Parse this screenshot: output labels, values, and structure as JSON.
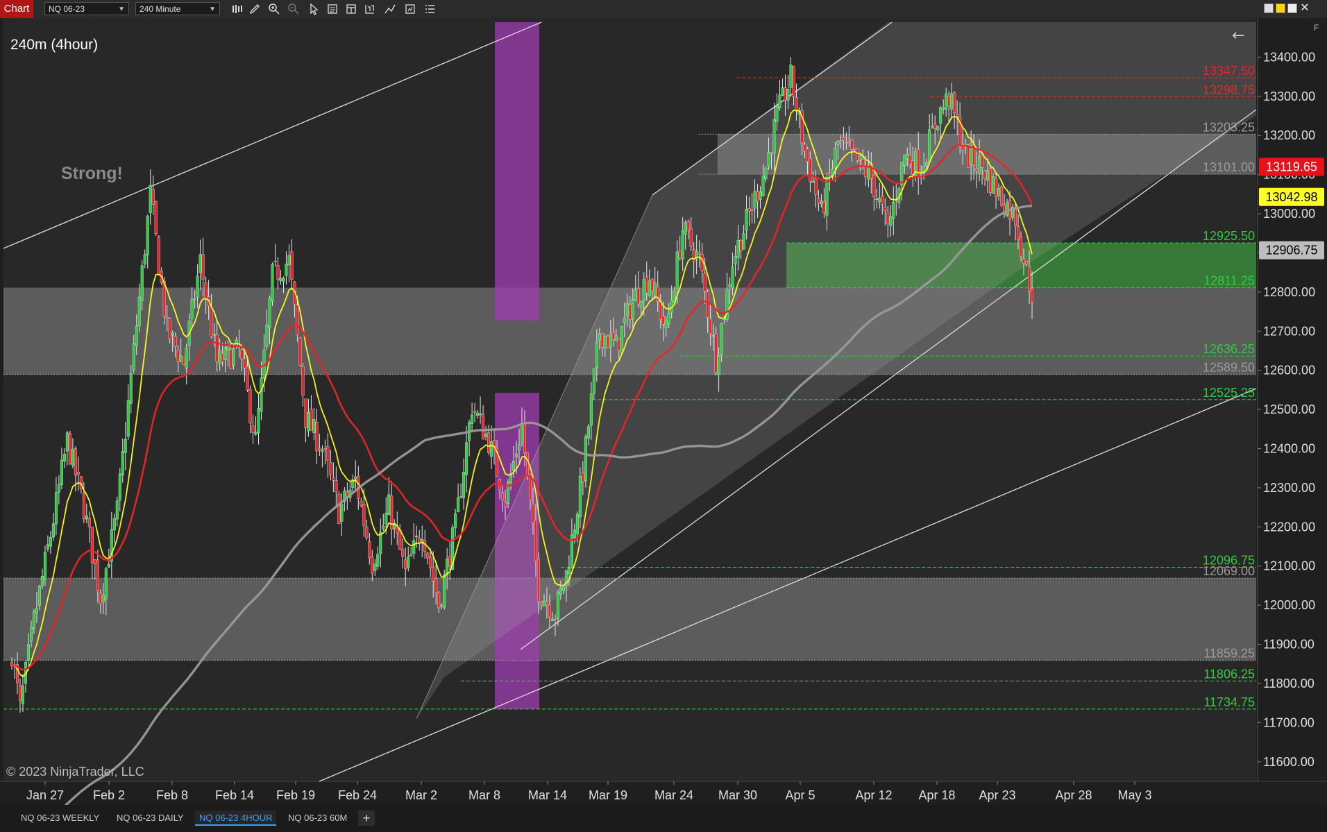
{
  "toolbar": {
    "chart_label": "Chart",
    "instrument": "NQ 06-23",
    "period": "240 Minute",
    "icons": [
      "bar-type-icon",
      "draw-pencil-icon",
      "zoom-in-icon",
      "zoom-out-icon",
      "pointer-icon",
      "data-box-icon",
      "properties-icon",
      "strategy-icon",
      "drawing-tools-icon",
      "templates-icon",
      "list-icon"
    ],
    "window_buttons": [
      "tile-icon",
      "restore-icon",
      "maximize-icon",
      "close-icon"
    ]
  },
  "chart": {
    "title": "240m (4hour)",
    "annotation": "Strong!",
    "copyright": "© 2023 NinjaTrader, LLC",
    "back_arrow": "←",
    "f_label": "F",
    "colors": {
      "background": "#282828",
      "ema_fast": "#ffff22",
      "ema_mid": "#e8262a",
      "sma_slow": "#9a9a9a",
      "up_candle": "#2ecc40",
      "down_candle": "#e8262a",
      "purple": "#a03cb0",
      "green_zone": "#3a8a3a"
    }
  },
  "chart_data": {
    "type": "candlestick",
    "instrument": "NQ 06-23",
    "interval": "240 Minute",
    "ylim": [
      11550,
      13500
    ],
    "y_ticks": [
      11600,
      11700,
      11800,
      11900,
      12000,
      12100,
      12200,
      12300,
      12400,
      12500,
      12600,
      12700,
      12800,
      12900,
      13000,
      13100,
      13200,
      13300,
      13400
    ],
    "y_tick_labels": [
      "11600.00",
      "11700.00",
      "11800.00",
      "11900.00",
      "12000.00",
      "12100.00",
      "12200.00",
      "12300.00",
      "12400.00",
      "12500.00",
      "12600.00",
      "12700.00",
      "12800.00",
      "12900.00",
      "13000.00",
      "13100.00",
      "13200.00",
      "13300.00",
      "13400.00"
    ],
    "x_labels": [
      "Jan 27",
      "Feb 2",
      "Feb 8",
      "Feb 14",
      "Feb 19",
      "Feb 24",
      "Mar 2",
      "Mar 8",
      "Mar 14",
      "Mar 19",
      "Mar 24",
      "Mar 30",
      "Apr 5",
      "Apr 12",
      "Apr 18",
      "Apr 23",
      "Apr 28",
      "May 3"
    ],
    "bars_total": 300,
    "bars_with_data": 289,
    "price_anchors": [
      [
        0,
        11880
      ],
      [
        3,
        11735
      ],
      [
        8,
        11960
      ],
      [
        14,
        12180
      ],
      [
        20,
        12420
      ],
      [
        26,
        12250
      ],
      [
        32,
        12020
      ],
      [
        38,
        12240
      ],
      [
        44,
        12650
      ],
      [
        50,
        13050
      ],
      [
        56,
        12700
      ],
      [
        62,
        12620
      ],
      [
        68,
        12880
      ],
      [
        74,
        12620
      ],
      [
        82,
        12650
      ],
      [
        88,
        12420
      ],
      [
        94,
        12840
      ],
      [
        100,
        12880
      ],
      [
        106,
        12480
      ],
      [
        112,
        12400
      ],
      [
        118,
        12240
      ],
      [
        124,
        12320
      ],
      [
        130,
        12110
      ],
      [
        136,
        12250
      ],
      [
        142,
        12080
      ],
      [
        148,
        12200
      ],
      [
        154,
        12000
      ],
      [
        160,
        12200
      ],
      [
        166,
        12510
      ],
      [
        172,
        12420
      ],
      [
        178,
        12270
      ],
      [
        184,
        12460
      ],
      [
        190,
        12040
      ],
      [
        196,
        11980
      ],
      [
        200,
        12080
      ],
      [
        206,
        12340
      ],
      [
        212,
        12700
      ],
      [
        218,
        12660
      ],
      [
        224,
        12780
      ],
      [
        230,
        12840
      ],
      [
        236,
        12700
      ],
      [
        242,
        12960
      ],
      [
        248,
        12880
      ],
      [
        254,
        12630
      ],
      [
        260,
        12880
      ],
      [
        266,
        13000
      ],
      [
        272,
        13120
      ],
      [
        276,
        13250
      ],
      [
        281,
        13347
      ],
      [
        286,
        13160
      ],
      [
        292,
        13000
      ],
      [
        298,
        13180
      ],
      [
        304,
        13140
      ],
      [
        310,
        13090
      ],
      [
        316,
        12960
      ],
      [
        322,
        13150
      ],
      [
        328,
        13120
      ],
      [
        334,
        13250
      ],
      [
        338,
        13298
      ],
      [
        344,
        13150
      ],
      [
        350,
        13120
      ],
      [
        356,
        13050
      ],
      [
        362,
        12990
      ],
      [
        366,
        12850
      ],
      [
        368,
        12800
      ]
    ],
    "levels": [
      {
        "price": 13347.5,
        "label": "13347.50",
        "color": "#e8262a",
        "style": "dashed",
        "x_start": 0.585
      },
      {
        "price": 13298.75,
        "label": "13298.75",
        "color": "#e8262a",
        "style": "dashed",
        "x_start": 0.74
      },
      {
        "price": 13203.25,
        "label": "13203.25",
        "color": "#9a9a9a",
        "style": "dotted",
        "x_start": 0.555
      },
      {
        "price": 13101.0,
        "label": "13101.00",
        "color": "#9a9a9a",
        "style": "dotted",
        "x_start": 0.555
      },
      {
        "price": 12925.5,
        "label": "12925.50",
        "color": "#2ecc40",
        "style": "dashed",
        "x_start": 0.625
      },
      {
        "price": 12811.25,
        "label": "12811.25",
        "color": "#2ecc40",
        "style": "dashed",
        "x_start": 0.625
      },
      {
        "price": 12636.25,
        "label": "12636.25",
        "color": "#2ecc40",
        "style": "dashed",
        "x_start": 0.54
      },
      {
        "price": 12589.5,
        "label": "12589.50",
        "color": "#9a9a9a",
        "style": "dotted",
        "x_start": 0
      },
      {
        "price": 12525.25,
        "label": "12525.25",
        "color": "#2ecc40",
        "style": "dashed",
        "x_start": 0.47
      },
      {
        "price": 12096.75,
        "label": "12096.75",
        "color": "#2ecc40",
        "style": "dashed",
        "x_start": 0.445
      },
      {
        "price": 12069.0,
        "label": "12069.00",
        "color": "#9a9a9a",
        "style": "dotted",
        "x_start": 0
      },
      {
        "price": 11859.25,
        "label": "11859.25",
        "color": "#9a9a9a",
        "style": "dotted",
        "x_start": 0
      },
      {
        "price": 11806.25,
        "label": "11806.25",
        "color": "#2ecc40",
        "style": "dashed",
        "x_start": 0.365
      },
      {
        "price": 11734.75,
        "label": "11734.75",
        "color": "#2ecc40",
        "style": "dashed",
        "x_start": 0
      }
    ],
    "price_tags": [
      {
        "price": 13119.65,
        "label": "13119.65",
        "bg": "#e8101a",
        "fg": "#ffffff"
      },
      {
        "price": 13042.98,
        "label": "13042.98",
        "bg": "#ffff22",
        "fg": "#000000"
      },
      {
        "price": 12906.75,
        "label": "12906.75",
        "bg": "#bdbdbd",
        "fg": "#000000"
      }
    ],
    "zones": [
      {
        "name": "upper-grey-zone",
        "from_price": 12589.5,
        "to_price": 12811.25,
        "x_start": 0,
        "x_end": 1,
        "color": "rgba(190,190,190,0.35)"
      },
      {
        "name": "lower-grey-zone",
        "from_price": 11859.25,
        "to_price": 12069.0,
        "x_start": 0,
        "x_end": 1,
        "color": "rgba(190,190,190,0.35)"
      },
      {
        "name": "top-grey-zone",
        "from_price": 13101.0,
        "to_price": 13203.25,
        "x_start": 0.57,
        "x_end": 1,
        "color": "rgba(190,190,190,0.35)"
      },
      {
        "name": "green-demand-zone",
        "from_price": 12811.25,
        "to_price": 12925.5,
        "x_start": 0.625,
        "x_end": 1,
        "color": "rgba(60,150,60,0.75)"
      }
    ]
  },
  "bottom_tabs": {
    "items": [
      "NQ 06-23 WEEKLY",
      "NQ 06-23 DAILY",
      "NQ 06-23 4HOUR",
      "NQ 06-23 60M"
    ],
    "active_index": 2,
    "add_label": "+"
  }
}
